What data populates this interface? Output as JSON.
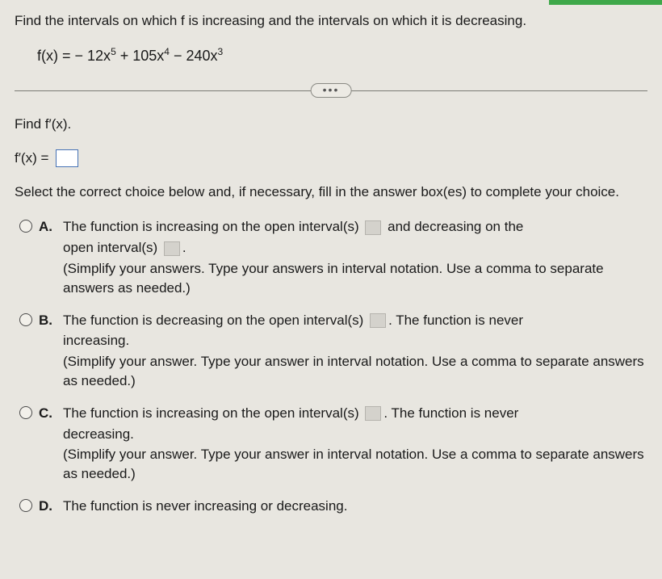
{
  "question": {
    "prompt": "Find the intervals on which f is increasing and the intervals on which it is decreasing.",
    "equation_prefix": "f(x) = ",
    "equation_terms": "− 12x⁵ + 105x⁴ − 240x³"
  },
  "findprime": {
    "label": "Find f′(x).",
    "lhs": "f′(x) ="
  },
  "select_prompt": "Select the correct choice below and, if necessary, fill in the answer box(es) to complete your choice.",
  "choices": {
    "a": {
      "letter": "A.",
      "part1": "The function is increasing on the open interval(s)",
      "part2": "and decreasing on the",
      "part3": "open interval(s)",
      "part4": ".",
      "hint": "(Simplify your answers. Type your answers in interval notation. Use a comma to separate answers as needed.)"
    },
    "b": {
      "letter": "B.",
      "part1": "The function is decreasing on the open interval(s)",
      "part2": ". The function is never",
      "part3": "increasing.",
      "hint": "(Simplify your answer. Type your answer in interval notation. Use a comma to separate answers as needed.)"
    },
    "c": {
      "letter": "C.",
      "part1": "The function is increasing on the open interval(s)",
      "part2": ". The function is never",
      "part3": "decreasing.",
      "hint": "(Simplify your answer. Type your answer in interval notation. Use a comma to separate answers as needed.)"
    },
    "d": {
      "letter": "D.",
      "text": "The function is never increasing or decreasing."
    }
  },
  "ellipsis": "•••"
}
